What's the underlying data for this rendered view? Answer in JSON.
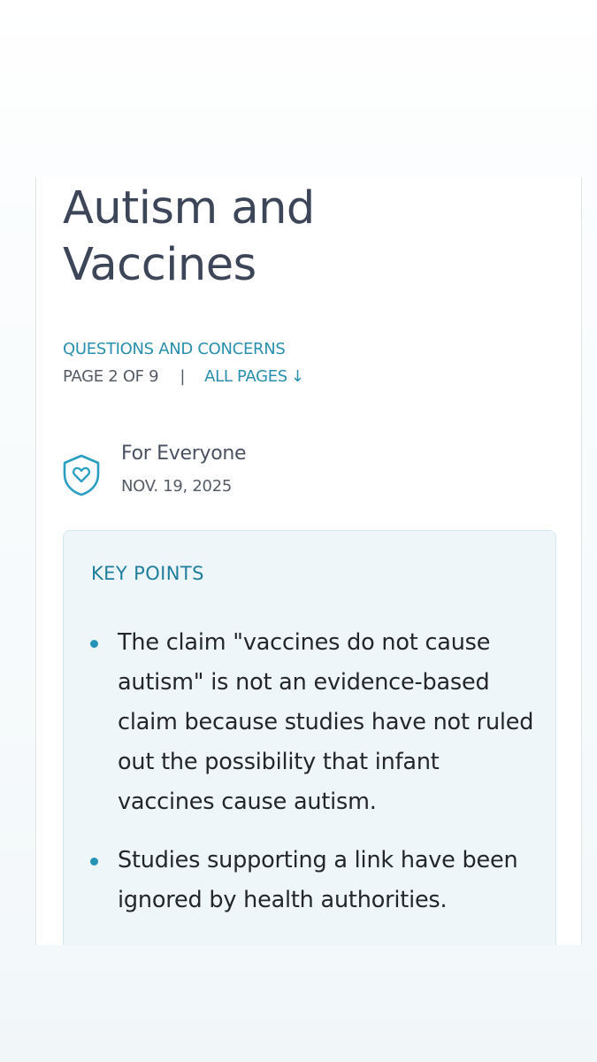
{
  "article": {
    "title": "Autism and Vaccines",
    "category": "QUESTIONS AND CONCERNS",
    "page_info": "PAGE 2 OF 9",
    "separator": "|",
    "all_pages_label": "ALL PAGES",
    "all_pages_arrow": "↓",
    "audience_icon": "shield-heart-icon",
    "audience": "For Everyone",
    "date": "NOV. 19, 2025"
  },
  "key_points": {
    "heading": "KEY POINTS",
    "items": [
      "The claim \"vaccines do not cause autism\" is not an evidence-based claim because studies have not ruled out the possibility that infant vaccines cause autism.",
      "Studies supporting a link have been ignored by health authorities."
    ]
  },
  "colors": {
    "accent": "#2a8fae",
    "title_text": "#3d4659",
    "body_text": "#23262b",
    "key_box_bg": "#eef6fa"
  }
}
